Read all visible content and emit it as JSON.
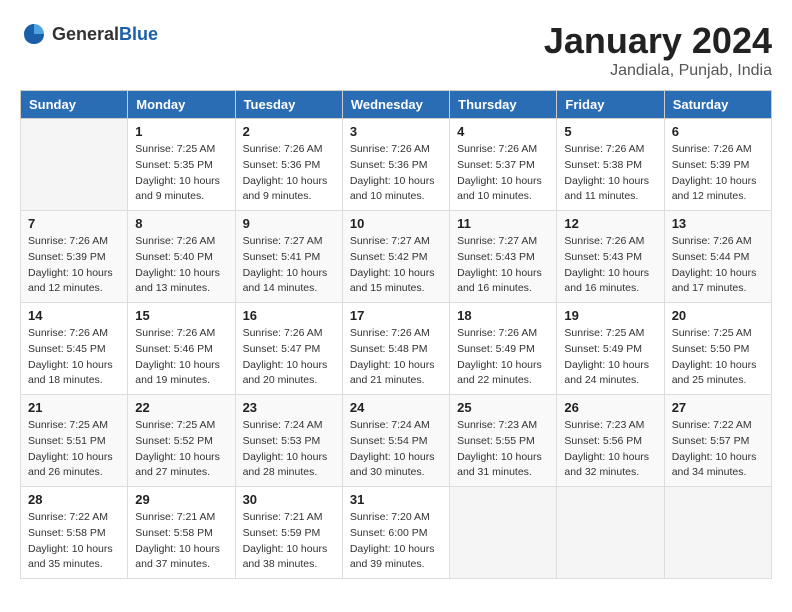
{
  "logo": {
    "text_general": "General",
    "text_blue": "Blue"
  },
  "title": "January 2024",
  "subtitle": "Jandiala, Punjab, India",
  "headers": [
    "Sunday",
    "Monday",
    "Tuesday",
    "Wednesday",
    "Thursday",
    "Friday",
    "Saturday"
  ],
  "weeks": [
    [
      {
        "day": "",
        "info": ""
      },
      {
        "day": "1",
        "info": "Sunrise: 7:25 AM\nSunset: 5:35 PM\nDaylight: 10 hours\nand 9 minutes."
      },
      {
        "day": "2",
        "info": "Sunrise: 7:26 AM\nSunset: 5:36 PM\nDaylight: 10 hours\nand 9 minutes."
      },
      {
        "day": "3",
        "info": "Sunrise: 7:26 AM\nSunset: 5:36 PM\nDaylight: 10 hours\nand 10 minutes."
      },
      {
        "day": "4",
        "info": "Sunrise: 7:26 AM\nSunset: 5:37 PM\nDaylight: 10 hours\nand 10 minutes."
      },
      {
        "day": "5",
        "info": "Sunrise: 7:26 AM\nSunset: 5:38 PM\nDaylight: 10 hours\nand 11 minutes."
      },
      {
        "day": "6",
        "info": "Sunrise: 7:26 AM\nSunset: 5:39 PM\nDaylight: 10 hours\nand 12 minutes."
      }
    ],
    [
      {
        "day": "7",
        "info": "Sunrise: 7:26 AM\nSunset: 5:39 PM\nDaylight: 10 hours\nand 12 minutes."
      },
      {
        "day": "8",
        "info": "Sunrise: 7:26 AM\nSunset: 5:40 PM\nDaylight: 10 hours\nand 13 minutes."
      },
      {
        "day": "9",
        "info": "Sunrise: 7:27 AM\nSunset: 5:41 PM\nDaylight: 10 hours\nand 14 minutes."
      },
      {
        "day": "10",
        "info": "Sunrise: 7:27 AM\nSunset: 5:42 PM\nDaylight: 10 hours\nand 15 minutes."
      },
      {
        "day": "11",
        "info": "Sunrise: 7:27 AM\nSunset: 5:43 PM\nDaylight: 10 hours\nand 16 minutes."
      },
      {
        "day": "12",
        "info": "Sunrise: 7:26 AM\nSunset: 5:43 PM\nDaylight: 10 hours\nand 16 minutes."
      },
      {
        "day": "13",
        "info": "Sunrise: 7:26 AM\nSunset: 5:44 PM\nDaylight: 10 hours\nand 17 minutes."
      }
    ],
    [
      {
        "day": "14",
        "info": "Sunrise: 7:26 AM\nSunset: 5:45 PM\nDaylight: 10 hours\nand 18 minutes."
      },
      {
        "day": "15",
        "info": "Sunrise: 7:26 AM\nSunset: 5:46 PM\nDaylight: 10 hours\nand 19 minutes."
      },
      {
        "day": "16",
        "info": "Sunrise: 7:26 AM\nSunset: 5:47 PM\nDaylight: 10 hours\nand 20 minutes."
      },
      {
        "day": "17",
        "info": "Sunrise: 7:26 AM\nSunset: 5:48 PM\nDaylight: 10 hours\nand 21 minutes."
      },
      {
        "day": "18",
        "info": "Sunrise: 7:26 AM\nSunset: 5:49 PM\nDaylight: 10 hours\nand 22 minutes."
      },
      {
        "day": "19",
        "info": "Sunrise: 7:25 AM\nSunset: 5:49 PM\nDaylight: 10 hours\nand 24 minutes."
      },
      {
        "day": "20",
        "info": "Sunrise: 7:25 AM\nSunset: 5:50 PM\nDaylight: 10 hours\nand 25 minutes."
      }
    ],
    [
      {
        "day": "21",
        "info": "Sunrise: 7:25 AM\nSunset: 5:51 PM\nDaylight: 10 hours\nand 26 minutes."
      },
      {
        "day": "22",
        "info": "Sunrise: 7:25 AM\nSunset: 5:52 PM\nDaylight: 10 hours\nand 27 minutes."
      },
      {
        "day": "23",
        "info": "Sunrise: 7:24 AM\nSunset: 5:53 PM\nDaylight: 10 hours\nand 28 minutes."
      },
      {
        "day": "24",
        "info": "Sunrise: 7:24 AM\nSunset: 5:54 PM\nDaylight: 10 hours\nand 30 minutes."
      },
      {
        "day": "25",
        "info": "Sunrise: 7:23 AM\nSunset: 5:55 PM\nDaylight: 10 hours\nand 31 minutes."
      },
      {
        "day": "26",
        "info": "Sunrise: 7:23 AM\nSunset: 5:56 PM\nDaylight: 10 hours\nand 32 minutes."
      },
      {
        "day": "27",
        "info": "Sunrise: 7:22 AM\nSunset: 5:57 PM\nDaylight: 10 hours\nand 34 minutes."
      }
    ],
    [
      {
        "day": "28",
        "info": "Sunrise: 7:22 AM\nSunset: 5:58 PM\nDaylight: 10 hours\nand 35 minutes."
      },
      {
        "day": "29",
        "info": "Sunrise: 7:21 AM\nSunset: 5:58 PM\nDaylight: 10 hours\nand 37 minutes."
      },
      {
        "day": "30",
        "info": "Sunrise: 7:21 AM\nSunset: 5:59 PM\nDaylight: 10 hours\nand 38 minutes."
      },
      {
        "day": "31",
        "info": "Sunrise: 7:20 AM\nSunset: 6:00 PM\nDaylight: 10 hours\nand 39 minutes."
      },
      {
        "day": "",
        "info": ""
      },
      {
        "day": "",
        "info": ""
      },
      {
        "day": "",
        "info": ""
      }
    ]
  ]
}
